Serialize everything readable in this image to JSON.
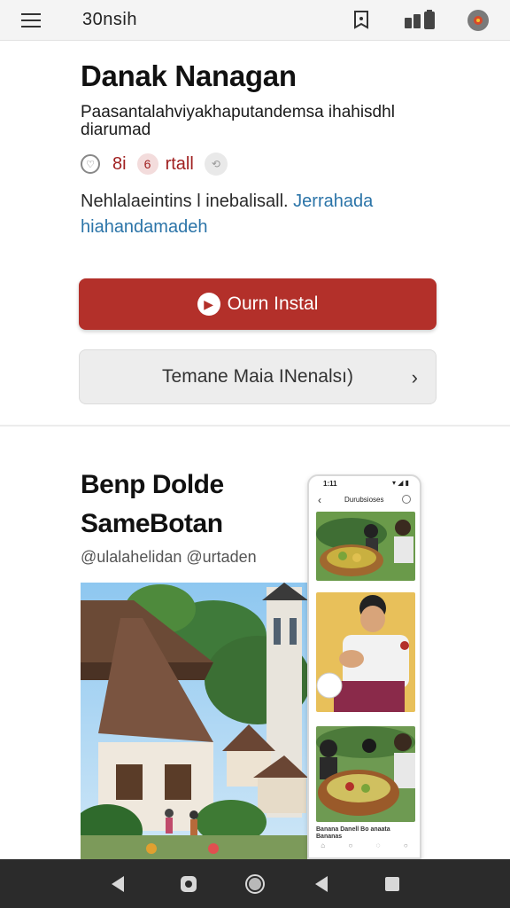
{
  "topbar": {
    "brand": "30nsih",
    "icons": [
      "menu-icon",
      "bookmark-icon",
      "battery-icon",
      "avatar-icon"
    ]
  },
  "hero": {
    "title": "Danak Nanagan",
    "subtitle": "Paasantalahviyakhaputandemsa ihahisdhl diarumad",
    "meta": {
      "count": "8i",
      "badge": "6",
      "label": "rtall"
    },
    "description": "Nehlalaeintins l inebalisall.",
    "description_link": "Jerrahada hiahandamadeh",
    "primary_button": "Ourn Instal",
    "secondary_button": "Temane Maia INenalsı)"
  },
  "section": {
    "title": "Benp Dolde SameBotan",
    "handle": "@ulalahelidan @urtaden"
  },
  "phone": {
    "time": "1:11",
    "signal": "▾ ◢ ▮",
    "header_title": "Durubsioses",
    "caption": "Banana Danell Bo anaata Bananas"
  },
  "colors": {
    "accent": "#b3302a",
    "link": "#2b74a8",
    "navbar": "#2b2b2b",
    "topbar": "#f4f4f4"
  }
}
